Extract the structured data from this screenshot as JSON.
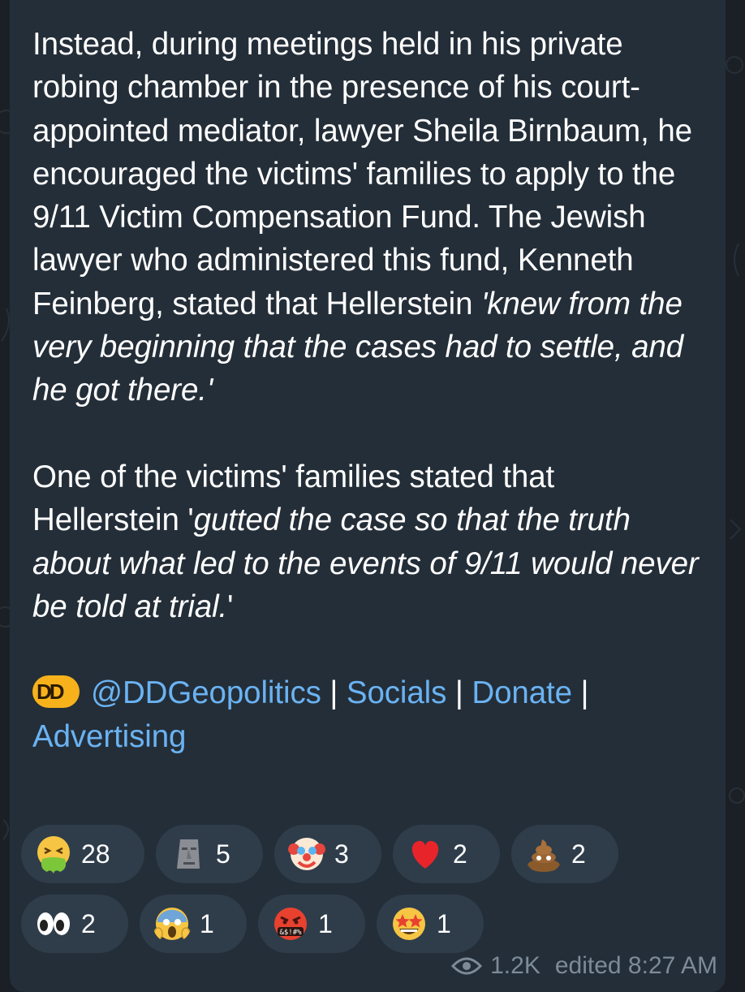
{
  "message": {
    "p1_a": "Instead, during meetings held in his private robing chamber in the presence of his court-appointed mediator, lawyer Sheila Birnbaum, he encouraged the victims' families to apply to the 9/11 Victim Compensation Fund. The Jewish lawyer who administered this fund, Kenneth Feinberg, stated that Hellerstein ",
    "p1_quote": "'knew from the very beginning that the cases had to settle, and he got there.'",
    "p2_a": "One of the victims' families stated that Hellerstein '",
    "p2_quote": "gutted the case so that the truth about what led to the events of 9/11 would never be told at trial.",
    "p2_end": "'"
  },
  "footer": {
    "logo_text": "DD",
    "handle": "@DDGeopolitics",
    "sep": " | ",
    "socials": "Socials",
    "donate": "Donate",
    "advertising": "Advertising"
  },
  "reactions": [
    {
      "emoji": "nauseated-face",
      "count": "28"
    },
    {
      "emoji": "moai",
      "count": "5"
    },
    {
      "emoji": "clown-face",
      "count": "3"
    },
    {
      "emoji": "red-heart",
      "count": "2"
    },
    {
      "emoji": "pile-of-poo",
      "count": "2"
    },
    {
      "emoji": "eyes",
      "count": "2"
    },
    {
      "emoji": "face-screaming-in-fear",
      "count": "1"
    },
    {
      "emoji": "face-with-symbols-on-mouth",
      "count": "1"
    },
    {
      "emoji": "star-struck",
      "count": "1"
    }
  ],
  "meta": {
    "views": "1.2K",
    "edited_label": "edited",
    "time": "8:27 AM"
  },
  "colors": {
    "bubble": "#242e38",
    "link": "#6ab3f3",
    "reaction_bg": "#2f3d4b"
  }
}
